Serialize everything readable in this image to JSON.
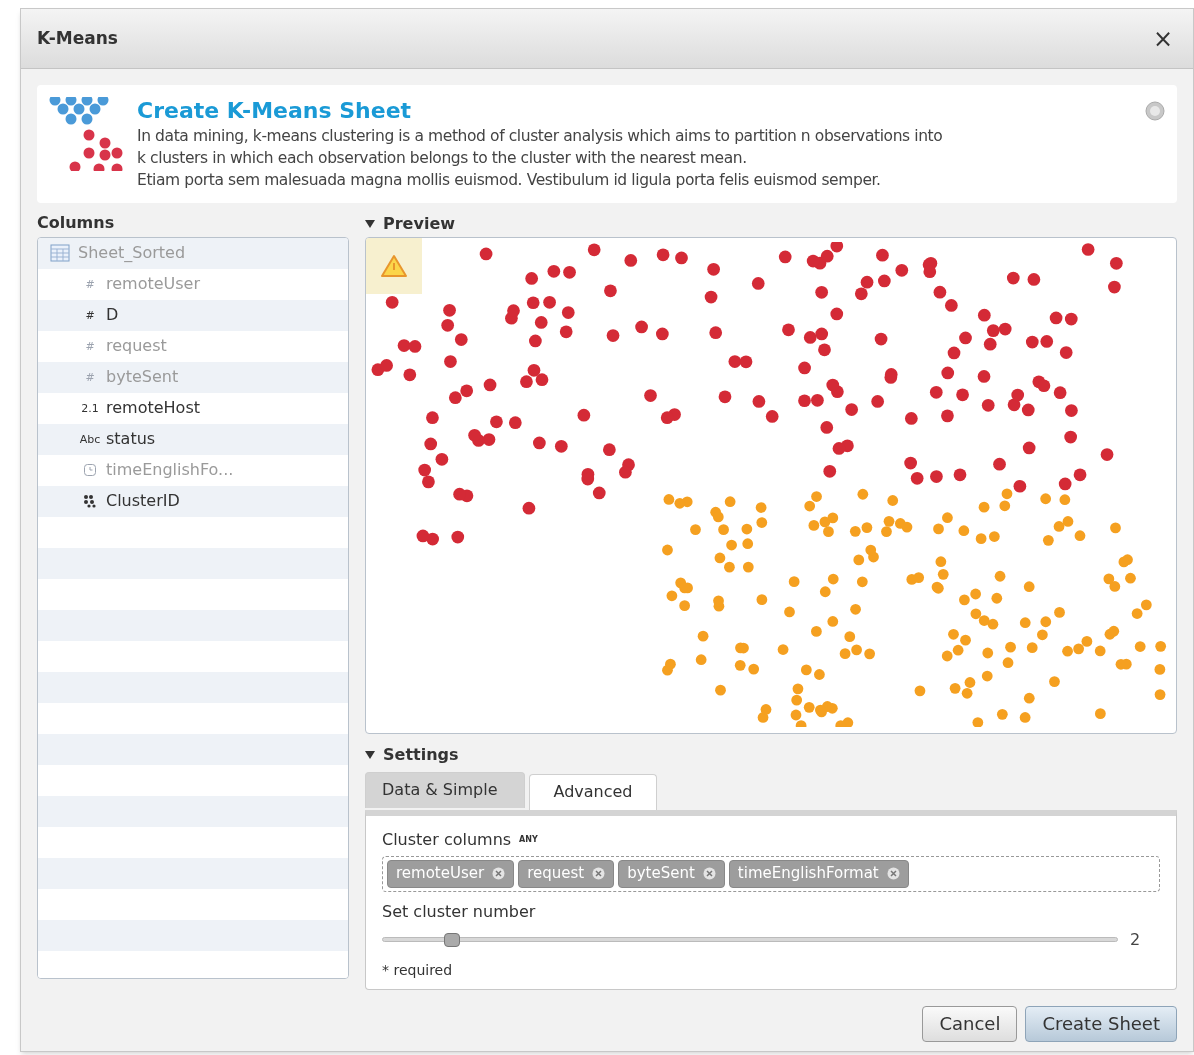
{
  "window": {
    "title": "K-Means",
    "close": "×"
  },
  "header": {
    "title": "Create K-Means Sheet",
    "description": [
      "In data mining, k-means clustering is a method of cluster analysis which aims to partition n observations into",
      "k clusters in which each observation belongs to the cluster with the nearest mean.",
      "Etiam porta sem malesuada magna mollis euismod. Vestibulum id ligula porta felis euismod semper."
    ]
  },
  "columns": {
    "title": "Columns",
    "tree": [
      {
        "label": "Sheet_Sorted",
        "kind": "table",
        "disabled": true,
        "children": [
          {
            "label": "remoteUser",
            "kind": "number",
            "type_label": "#",
            "disabled": true
          },
          {
            "label": "D",
            "kind": "number",
            "type_label": "#",
            "disabled": false
          },
          {
            "label": "request",
            "kind": "number",
            "type_label": "#",
            "disabled": true
          },
          {
            "label": "byteSent",
            "kind": "number",
            "type_label": "#",
            "disabled": true
          },
          {
            "label": "remoteHost",
            "kind": "decimal",
            "type_label": "2.1",
            "disabled": false
          },
          {
            "label": "status",
            "kind": "text",
            "type_label": "Abc",
            "disabled": false
          },
          {
            "label": "timeEnglishFo...",
            "kind": "time",
            "disabled": true
          },
          {
            "label": "ClusterID",
            "kind": "cluster",
            "disabled": false
          }
        ]
      }
    ]
  },
  "preview": {
    "title": "Preview",
    "expanded": true,
    "warning": true
  },
  "settings": {
    "title": "Settings",
    "expanded": true,
    "tabs": [
      {
        "label": "Data & Simple",
        "selected": true
      },
      {
        "label": "Advanced",
        "selected": false
      }
    ],
    "cluster_columns": {
      "label": "Cluster columns",
      "badge": "ANY",
      "tags": [
        "remoteUser",
        "request",
        "byteSent",
        "timeEnglishFormat"
      ]
    },
    "cluster_number": {
      "label": "Set cluster number",
      "level": 0.095,
      "value": "2"
    },
    "note": "* required"
  },
  "buttons": [
    {
      "label": "Cancel",
      "primary": false
    },
    {
      "label": "Create Sheet",
      "primary": true
    }
  ]
}
